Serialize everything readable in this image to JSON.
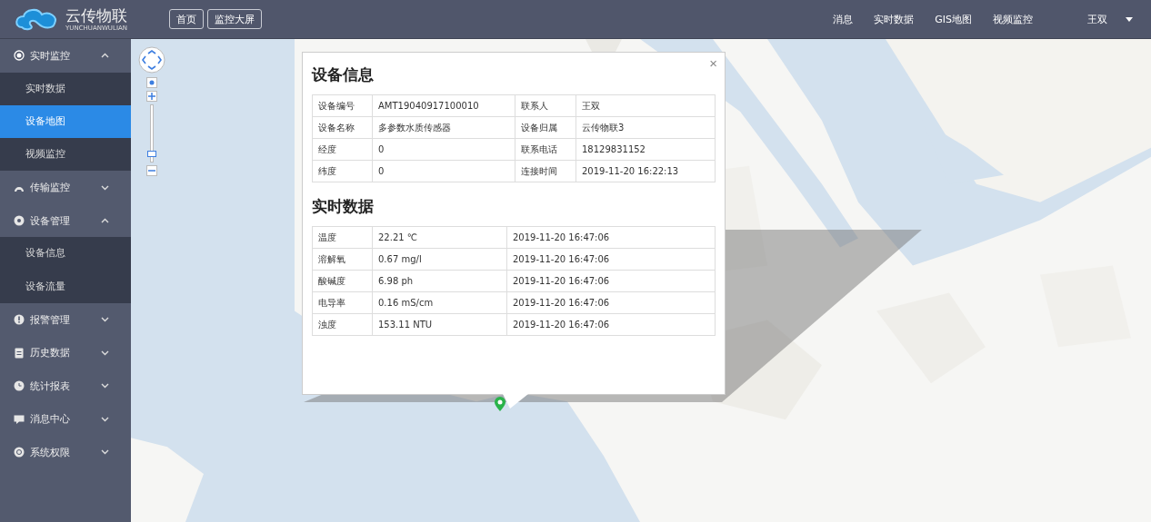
{
  "header": {
    "logo": {
      "name": "云传物联",
      "subtitle": "YUNCHUANWULIAN"
    },
    "buttons": [
      {
        "label": "首页"
      },
      {
        "label": "监控大屏"
      }
    ],
    "nav": [
      {
        "label": "消息"
      },
      {
        "label": "实时数据"
      },
      {
        "label": "GIS地图"
      },
      {
        "label": "视频监控"
      }
    ],
    "user": {
      "name": "王双"
    }
  },
  "sidebar": {
    "items": [
      {
        "label": "实时监控",
        "expanded": true,
        "children": [
          {
            "label": "实时数据",
            "selected": false
          },
          {
            "label": "设备地图",
            "selected": true
          },
          {
            "label": "视频监控",
            "selected": false
          }
        ]
      },
      {
        "label": "传输监控",
        "expanded": false
      },
      {
        "label": "设备管理",
        "expanded": true,
        "children": [
          {
            "label": "设备信息",
            "selected": false
          },
          {
            "label": "设备流量",
            "selected": false
          }
        ]
      },
      {
        "label": "报警管理",
        "expanded": false
      },
      {
        "label": "历史数据",
        "expanded": false
      },
      {
        "label": "统计报表",
        "expanded": false
      },
      {
        "label": "消息中心",
        "expanded": false
      },
      {
        "label": "系统权限",
        "expanded": false
      }
    ]
  },
  "map": {
    "kind": "picture",
    "zoom": {
      "level": 0.15
    },
    "popup": {
      "close": "×",
      "info_title": "设备信息",
      "info_rows": [
        {
          "label_1": "设备编号",
          "value_1": "AMT19040917100010",
          "label_2": "联系人",
          "value_2": "王双"
        },
        {
          "label_1": "设备名称",
          "value_1": "多参数水质传感器",
          "label_2": "设备归属",
          "value_2": "云传物联3"
        },
        {
          "label_1": "经度",
          "value_1": "0",
          "label_2": "联系电话",
          "value_2": "18129831152"
        },
        {
          "label_1": "纬度",
          "value_1": "0",
          "label_2": "连接时间",
          "value_2": "2019-11-20 16:22:13"
        }
      ],
      "data_title": "实时数据",
      "data_rows": [
        {
          "name": "温度",
          "value": "22.21  ℃",
          "time": "2019-11-20 16:47:06"
        },
        {
          "name": "溶解氧",
          "value": "0.67  mg/l",
          "time": "2019-11-20 16:47:06"
        },
        {
          "name": "酸碱度",
          "value": "6.98  ph",
          "time": "2019-11-20 16:47:06"
        },
        {
          "name": "电导率",
          "value": "0.16  mS/cm",
          "time": "2019-11-20 16:47:06"
        },
        {
          "name": "浊度",
          "value": "153.11  NTU",
          "time": "2019-11-20 16:47:06"
        }
      ]
    }
  }
}
